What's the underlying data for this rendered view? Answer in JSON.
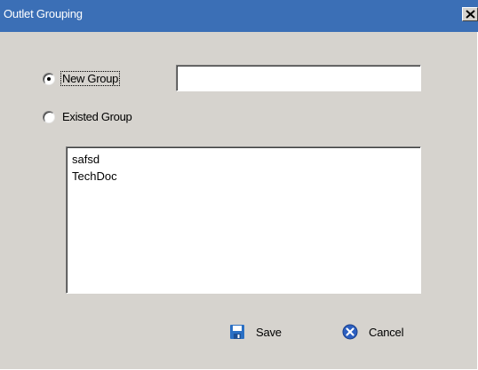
{
  "window": {
    "title": "Outlet Grouping",
    "close_glyph": "✕"
  },
  "options": {
    "new_group_label": "New Group",
    "new_group_selected": true,
    "existed_group_label": "Existed Group",
    "existed_group_selected": false
  },
  "new_group_input": {
    "value": ""
  },
  "group_list": {
    "items": [
      "safsd",
      "TechDoc"
    ]
  },
  "buttons": {
    "save_label": "Save",
    "save_icon": "floppy-disk-icon",
    "cancel_label": "Cancel",
    "cancel_icon": "close-circle-icon"
  },
  "colors": {
    "titlebar": "#3b6fb6",
    "dialog_background": "#d6d3ce",
    "save_icon": "#2a6fc4",
    "cancel_icon": "#2c5fc0"
  }
}
